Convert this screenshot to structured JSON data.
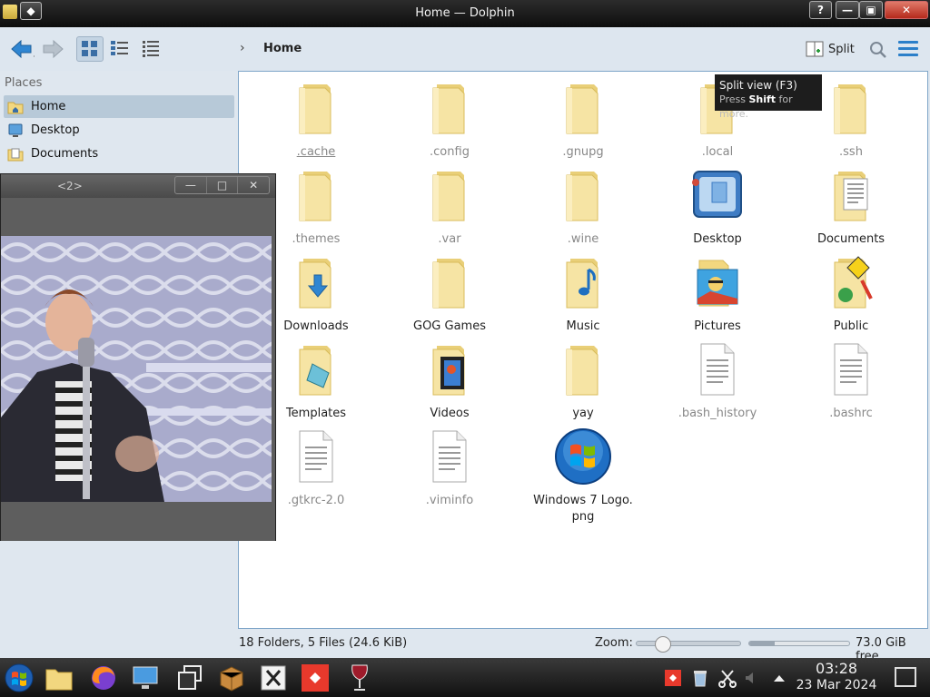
{
  "window": {
    "title": "Home — Dolphin",
    "pin_glyph": "◆",
    "help_glyph": "?",
    "minimize_glyph": "—",
    "maximize_glyph": "▣",
    "close_glyph": "✕"
  },
  "toolbar": {
    "breadcrumb": "Home",
    "breadcrumb_chevron": "›",
    "split_label": "Split"
  },
  "tooltip": {
    "title": "Split view (F3)",
    "sub_before": "Press ",
    "sub_key": "Shift",
    "sub_after": " for more."
  },
  "places": {
    "title": "Places",
    "items": [
      {
        "label": "Home"
      },
      {
        "label": "Desktop"
      },
      {
        "label": "Documents"
      }
    ]
  },
  "files": [
    {
      "label": ".cache"
    },
    {
      "label": ".config"
    },
    {
      "label": ".gnupg"
    },
    {
      "label": ".local"
    },
    {
      "label": ".ssh"
    },
    {
      "label": ".themes"
    },
    {
      "label": ".var"
    },
    {
      "label": ".wine"
    },
    {
      "label": "Desktop"
    },
    {
      "label": "Documents"
    },
    {
      "label": "Downloads"
    },
    {
      "label": "GOG Games"
    },
    {
      "label": "Music"
    },
    {
      "label": "Pictures"
    },
    {
      "label": "Public"
    },
    {
      "label": "Templates"
    },
    {
      "label": "Videos"
    },
    {
      "label": "yay"
    },
    {
      "label": ".bash_history"
    },
    {
      "label": ".bashrc"
    },
    {
      "label": ".gtkrc-2.0"
    },
    {
      "label": ".viminfo"
    },
    {
      "label": "Windows 7 Logo. png"
    }
  ],
  "video_window": {
    "title": "<2>",
    "min_glyph": "—",
    "max_glyph": "□",
    "close_glyph": "✕"
  },
  "status": {
    "summary": "18 Folders, 5 Files (24.6 KiB)",
    "zoom_label": "Zoom:",
    "zoom_level": 0.2,
    "disk_used_fraction": 0.25,
    "free_label": "73.0 GiB free"
  },
  "taskbar": {
    "time": "03:28",
    "date": "23 Mar 2024"
  },
  "colors": {
    "accent": "#2b7fc9",
    "folder": "#f2d77f",
    "folder_dark": "#d9b84f"
  }
}
